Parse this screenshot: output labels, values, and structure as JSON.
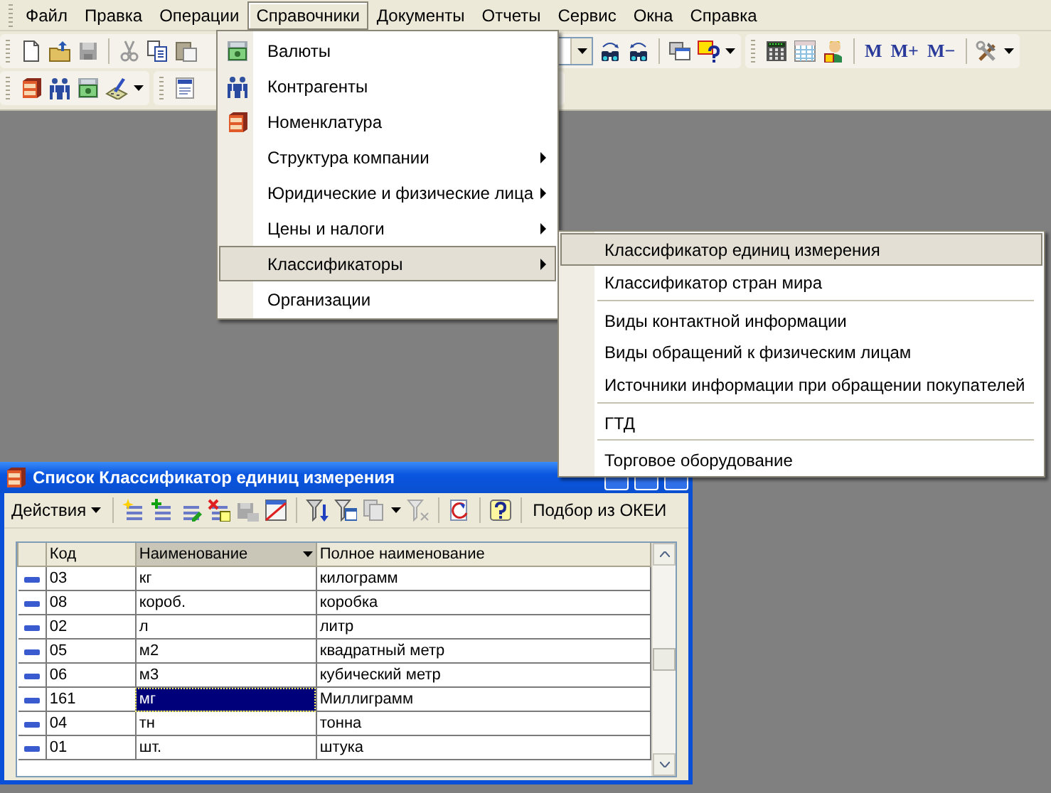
{
  "menubar": [
    {
      "label": "Файл",
      "selected": false
    },
    {
      "label": "Правка",
      "selected": false
    },
    {
      "label": "Операции",
      "selected": false
    },
    {
      "label": "Справочники",
      "selected": true
    },
    {
      "label": "Документы",
      "selected": false
    },
    {
      "label": "Отчеты",
      "selected": false
    },
    {
      "label": "Сервис",
      "selected": false
    },
    {
      "label": "Окна",
      "selected": false
    },
    {
      "label": "Справка",
      "selected": false
    }
  ],
  "memory_buttons": [
    {
      "label": "M"
    },
    {
      "label": "M+"
    },
    {
      "label": "M−"
    }
  ],
  "menu": {
    "items": [
      {
        "label": "Валюты",
        "submenu": false,
        "selected": false
      },
      {
        "label": "Контрагенты",
        "submenu": false,
        "selected": false
      },
      {
        "label": "Номенклатура",
        "submenu": false,
        "selected": false
      },
      {
        "label": "Структура компании",
        "submenu": true,
        "selected": false
      },
      {
        "label": "Юридические и физические лица",
        "submenu": true,
        "selected": false
      },
      {
        "label": "Цены и налоги",
        "submenu": true,
        "selected": false
      },
      {
        "label": "Классификаторы",
        "submenu": true,
        "selected": true
      },
      {
        "label": "Организации",
        "submenu": false,
        "selected": false
      }
    ]
  },
  "submenu": {
    "items": [
      {
        "label": "Классификатор единиц измерения",
        "separator_before": false,
        "selected": true
      },
      {
        "label": "Классификатор стран мира",
        "separator_before": false,
        "selected": false
      },
      {
        "label": "Виды контактной информации",
        "separator_before": true,
        "selected": false
      },
      {
        "label": "Виды обращений к физическим лицам",
        "separator_before": false,
        "selected": false
      },
      {
        "label": "Источники информации при обращении покупателей",
        "separator_before": false,
        "selected": false
      },
      {
        "label": "ГТД",
        "separator_before": true,
        "selected": false
      },
      {
        "label": "Торговое оборудование",
        "separator_before": true,
        "selected": false
      }
    ]
  },
  "list_window": {
    "title": "Список Классификатор единиц измерения",
    "actions_button": "Действия",
    "pick_button": "Подбор из ОКЕИ",
    "table": {
      "columns": [
        {
          "label": "Код",
          "sorted": false
        },
        {
          "label": "Наименование",
          "sorted": true
        },
        {
          "label": "Полное наименование",
          "sorted": false
        }
      ],
      "rows": [
        {
          "code": "03",
          "name": "кг",
          "full_name": "килограмм",
          "selected": false
        },
        {
          "code": "08",
          "name": "короб.",
          "full_name": "коробка",
          "selected": false
        },
        {
          "code": "02",
          "name": "л",
          "full_name": "литр",
          "selected": false
        },
        {
          "code": "05",
          "name": "м2",
          "full_name": "квадратный метр",
          "selected": false
        },
        {
          "code": "06",
          "name": "м3",
          "full_name": "кубический метр",
          "selected": false
        },
        {
          "code": "161",
          "name": "мг",
          "full_name": "Миллиграмм",
          "selected": true
        },
        {
          "code": "04",
          "name": "тн",
          "full_name": "тонна",
          "selected": false
        },
        {
          "code": "01",
          "name": "шт.",
          "full_name": "штука",
          "selected": false
        }
      ]
    }
  }
}
